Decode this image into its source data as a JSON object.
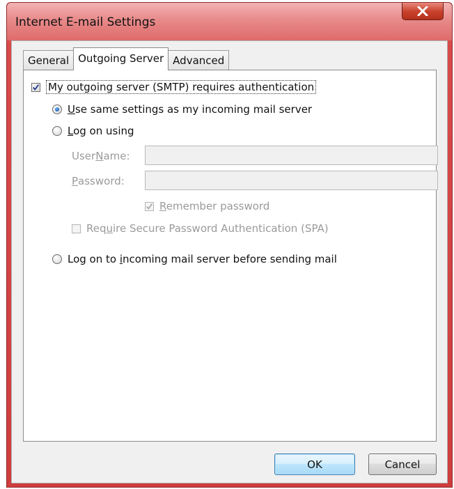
{
  "window": {
    "title": "Internet E-mail Settings",
    "close_symbol": "✕",
    "accent_color": "#d94a4a"
  },
  "tabs": [
    {
      "label": "General",
      "active": false
    },
    {
      "label": "Outgoing Server",
      "active": true
    },
    {
      "label": "Advanced",
      "active": false
    }
  ],
  "outgoing": {
    "smtp_auth": {
      "label": "My outgoing server (SMTP) requires authentication",
      "checked": true
    },
    "use_same": {
      "label_u": "U",
      "label_rest": "se same settings as my incoming mail server",
      "selected": true
    },
    "log_on_using": {
      "label_u": "L",
      "label_rest": "og on using",
      "selected": false
    },
    "user_name": {
      "label_pre": "User ",
      "label_u": "N",
      "label_rest": "ame:",
      "value": ""
    },
    "password": {
      "label_u": "P",
      "label_rest": "assword:",
      "value": ""
    },
    "remember_password": {
      "label_u": "R",
      "label_rest": "emember password",
      "checked": true,
      "disabled": true
    },
    "spa": {
      "label_pre": "Req",
      "label_u": "u",
      "label_rest": "ire Secure Password Authentication (SPA)",
      "checked": false,
      "disabled": true
    },
    "log_on_incoming": {
      "label_pre": "Log on to ",
      "label_u": "i",
      "label_rest": "ncoming mail server before sending mail",
      "selected": false
    }
  },
  "buttons": {
    "ok": "OK",
    "cancel": "Cancel"
  }
}
